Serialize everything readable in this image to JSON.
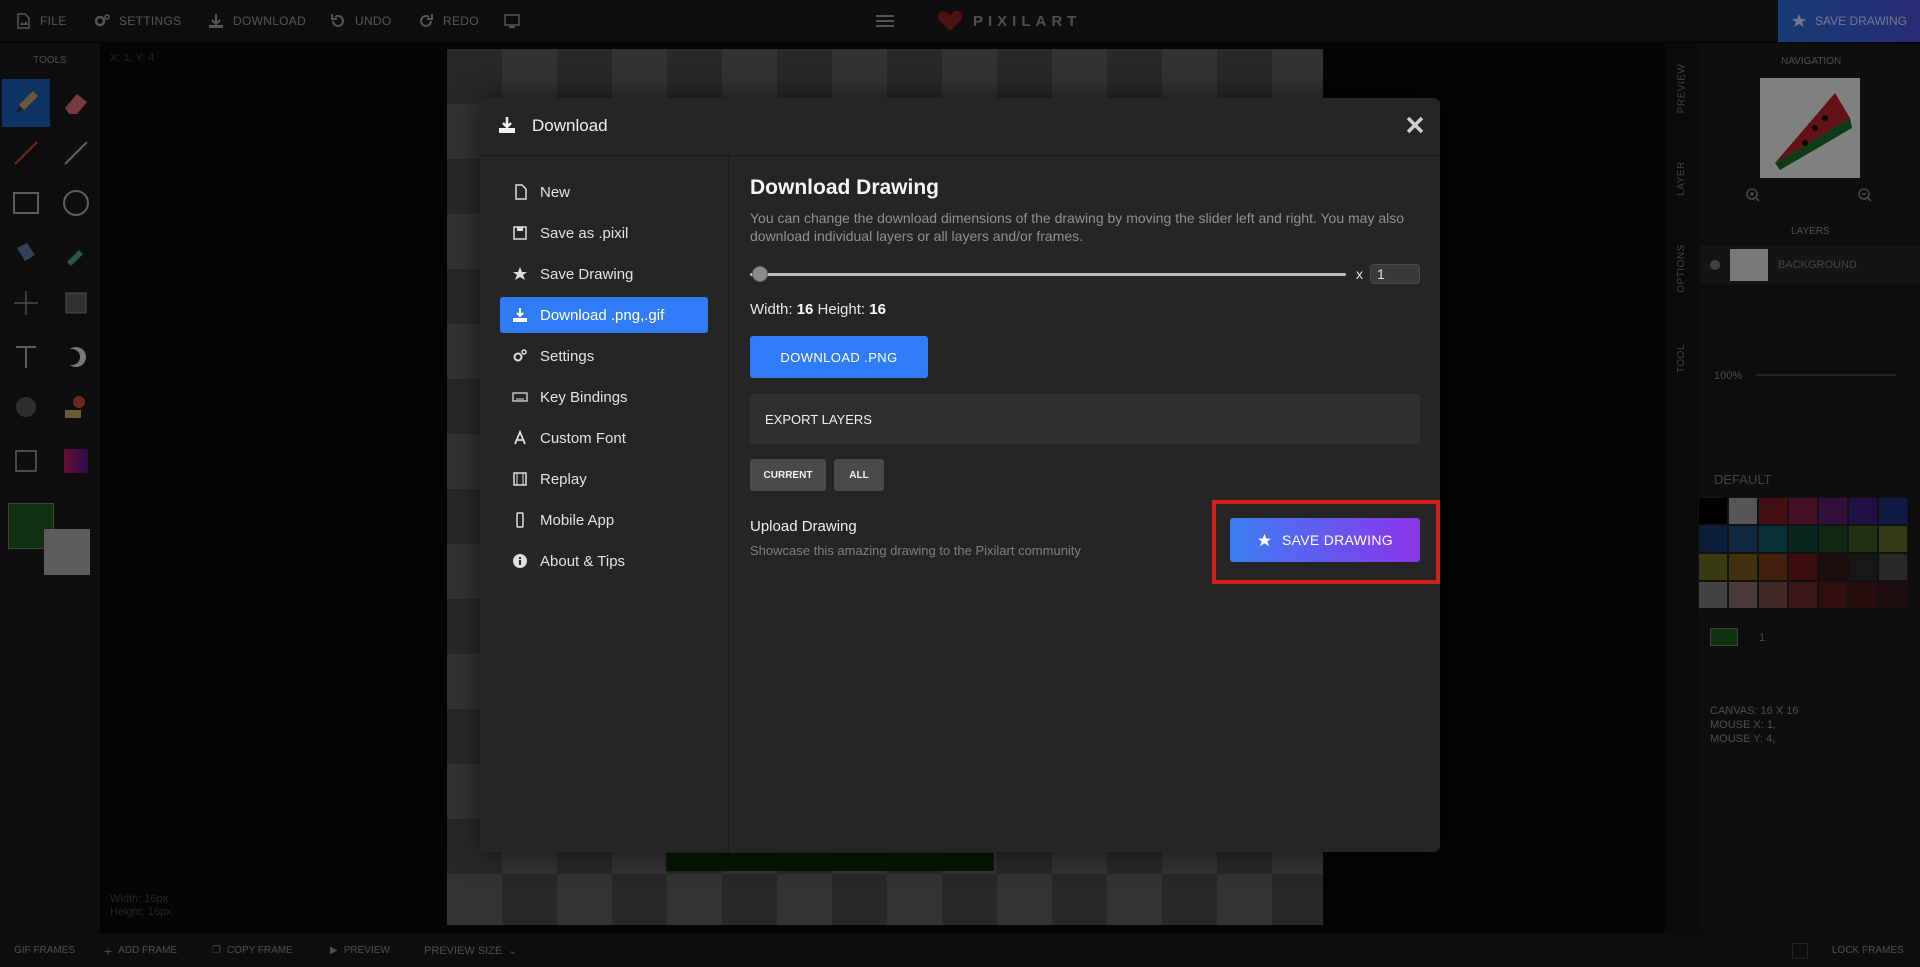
{
  "topbar": {
    "file": "FILE",
    "settings": "SETTINGS",
    "download": "DOWNLOAD",
    "undo": "UNDO",
    "redo": "REDO",
    "logo": "PIXILART",
    "save_drawing": "SAVE DRAWING"
  },
  "left": {
    "tools_title": "TOOLS",
    "coords": "X: 1, Y: 4",
    "width": "Width: 16px",
    "height": "Height: 16px"
  },
  "right": {
    "tabs": [
      "PREVIEW",
      "LAYER",
      "OPTIONS",
      "TOOL"
    ],
    "navigation": "NAVIGATION",
    "layers": "LAYERS",
    "layer_name": "BACKGROUND",
    "zoom": "100%",
    "palette_name": "DEFAULT",
    "brush_size": "1",
    "canvas": "CANVAS: 16 X 16",
    "mouse_x": "MOUSE X: 1,",
    "mouse_y": "MOUSE Y: 4,",
    "palette_colors": [
      "#000000",
      "#9d9d9d",
      "#7a1c24",
      "#7a1c44",
      "#5a1c6a",
      "#3a1c7a",
      "#20307a",
      "#163a6a",
      "#1a4a7a",
      "#0f5a6a",
      "#0f4a3a",
      "#1a4a22",
      "#3a5a22",
      "#5a6a22",
      "#6a6a20",
      "#7a5a1a",
      "#7a3a1a",
      "#6a1a1a",
      "#3a1a1a",
      "#2a2a2a",
      "#4a4a4a",
      "#7a7a7a",
      "#8a6a6a",
      "#7a4a4a",
      "#6a2a2a",
      "#5a1a1a",
      "#4a1a1a",
      "#3a1a1a"
    ],
    "primary_color": "#1d5a22"
  },
  "bottombar": {
    "gif_frames": "GIF FRAMES",
    "add_frame": "ADD FRAME",
    "copy_frame": "COPY FRAME",
    "preview": "PREVIEW",
    "preview_size": "PREVIEW SIZE",
    "lock_frames": "LOCK FRAMES"
  },
  "modal": {
    "title": "Download",
    "menu": [
      {
        "label": "New",
        "icon": "file-icon"
      },
      {
        "label": "Save as .pixil",
        "icon": "floppy-icon"
      },
      {
        "label": "Save Drawing",
        "icon": "star-icon"
      },
      {
        "label": "Download .png,.gif",
        "icon": "download-icon",
        "active": true
      },
      {
        "label": "Settings",
        "icon": "gears-icon"
      },
      {
        "label": "Key Bindings",
        "icon": "keyboard-icon"
      },
      {
        "label": "Custom Font",
        "icon": "font-icon"
      },
      {
        "label": "Replay",
        "icon": "film-icon"
      },
      {
        "label": "Mobile App",
        "icon": "mobile-icon"
      },
      {
        "label": "About & Tips",
        "icon": "info-icon"
      }
    ],
    "content": {
      "title": "Download Drawing",
      "description": "You can change the download dimensions of the drawing by moving the slider left and right. You may also download individual layers or all layers and/or frames.",
      "scale_x": "x",
      "scale_value": "1",
      "width_label": "Width:",
      "width_value": "16",
      "height_label": "Height:",
      "height_value": "16",
      "download_png": "DOWNLOAD .PNG",
      "export_layers": "EXPORT LAYERS",
      "current": "CURRENT",
      "all": "ALL",
      "upload_title": "Upload Drawing",
      "upload_desc": "Showcase this amazing drawing to the Pixilart community",
      "save_drawing": "SAVE DRAWING"
    }
  }
}
